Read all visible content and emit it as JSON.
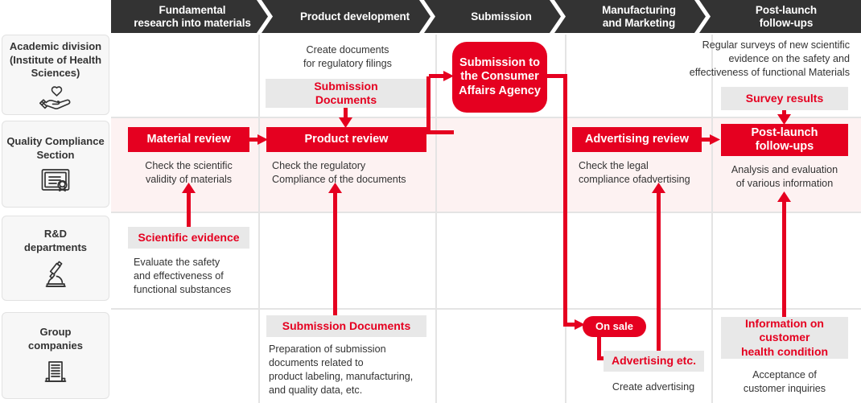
{
  "phases": [
    {
      "label": "Fundamental\nresearch into materials"
    },
    {
      "label": "Product development"
    },
    {
      "label": "Submission"
    },
    {
      "label": "Manufacturing\nand Marketing"
    },
    {
      "label": "Post-launch\nfollow-ups"
    }
  ],
  "rows": [
    {
      "label": "Academic division\n(Institute of Health\nSciences)",
      "icon": "hand-heart-icon"
    },
    {
      "label": "Quality Compliance\nSection",
      "icon": "certificate-icon"
    },
    {
      "label": "R&D\ndepartments",
      "icon": "microscope-icon"
    },
    {
      "label": "Group\ncompanies",
      "icon": "building-icon"
    }
  ],
  "items": {
    "create_documents_note": "Create documents\nfor regulatory filings",
    "submission_documents_box": "Submission\nDocuments",
    "submission_to_caa_box": "Submission to\nthe Consumer\nAffairs Agency",
    "regular_surveys_note": "Regular surveys of new scientific\nevidence on the safety and\neffectiveness of functional Materials",
    "survey_results_box": "Survey results",
    "material_review_box": "Material review",
    "material_review_note": "Check the scientific\nvalidity of materials",
    "product_review_box": "Product review",
    "product_review_note": "Check the regulatory\nCompliance of the documents",
    "advertising_review_box": "Advertising review",
    "advertising_review_note": "Check the legal\ncompliance ofadvertising",
    "post_launch_followups_box": "Post-launch\nfollow-ups",
    "post_launch_followups_note": "Analysis and evaluation\nof various information",
    "scientific_evidence_box": "Scientific evidence",
    "scientific_evidence_note": "Evaluate the safety\nand effectiveness of\nfunctional substances",
    "submission_documents_group_box": "Submission Documents",
    "submission_documents_group_note": "Preparation of submission\ndocuments related to\nproduct labeling, manufacturing,\nand quality data, etc.",
    "on_sale_box": "On sale",
    "advertising_etc_box": "Advertising etc.",
    "advertising_etc_note": "Create advertising",
    "customer_health_box": "Information on\ncustomer\nhealth condition",
    "customer_health_note": "Acceptance of\ncustomer inquiries"
  },
  "colors": {
    "accent_red": "#e50020",
    "header_dark": "#333333",
    "box_grey": "#e8e8e8",
    "row_highlight_pink": "#fdf2f2",
    "row_label_bg": "#f7f7f7",
    "grid_line": "#e4e4e4",
    "text_dark": "#333333"
  }
}
